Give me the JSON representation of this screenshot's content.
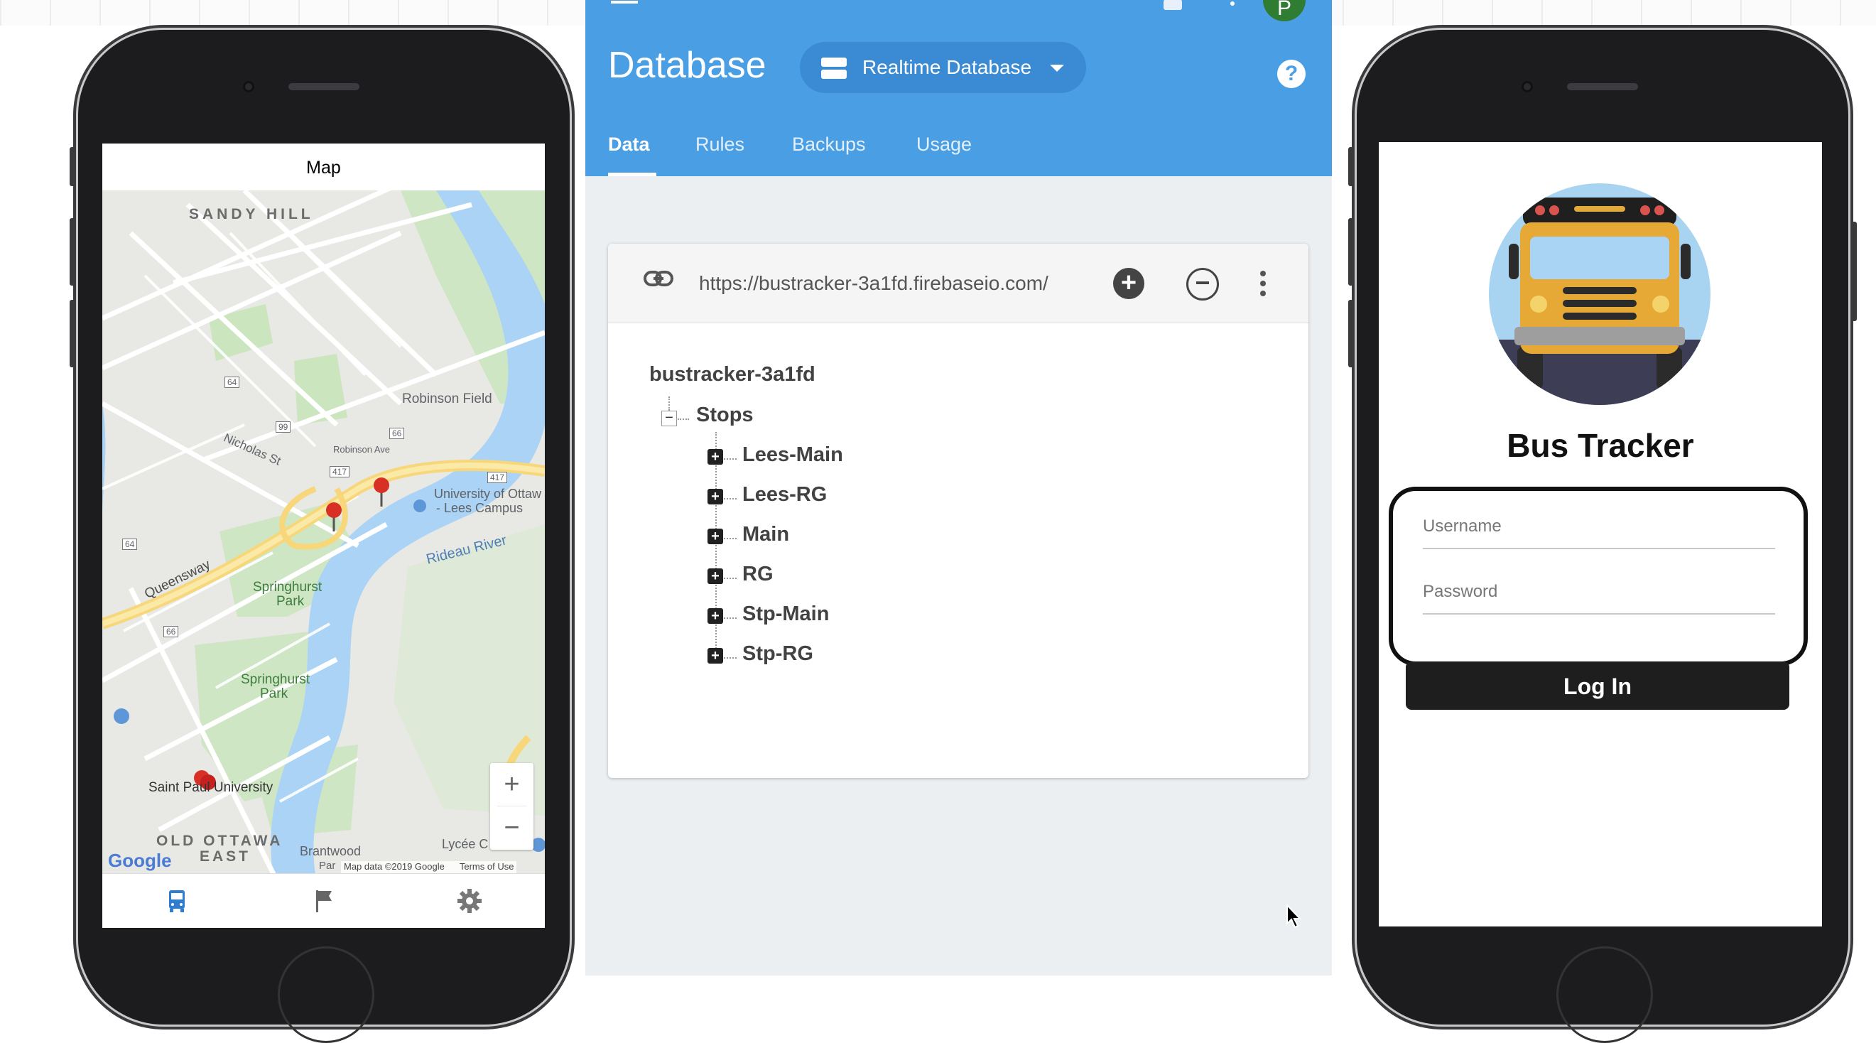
{
  "map_app": {
    "title": "Map",
    "zoom_in": "+",
    "zoom_out": "−",
    "labels": {
      "sandy_hill": "SANDY HILL",
      "robinson_field": "Robinson Field",
      "nicholas_st": "Nicholas St",
      "robinson_ave": "Robinson Ave",
      "university": "University of Ottaw",
      "lees_campus": "- Lees Campus",
      "queensway": "Queensway",
      "springhurst_park_1": "Springhurst",
      "springhurst_park_1b": "Park",
      "springhurst_park_2": "Springhurst",
      "springhurst_park_2b": "Park",
      "rideau_river": "Rideau River",
      "saint_paul": "Saint Paul University",
      "old_ottawa_east": "OLD OTTAWA",
      "old_ottawa_east_b": "EAST",
      "brantwood": "Brantwood",
      "lycee": "Lycée C",
      "google": "Google",
      "map_data": "Map data ©2019 Google",
      "terms": "Terms of Use",
      "par": "Par",
      "hwy_417": "417",
      "hwy_417b": "417",
      "rd_64": "64",
      "rd_64b": "64",
      "rd_99": "99",
      "rd_66": "66",
      "rd_66b": "66"
    },
    "tabs": [
      "bus-icon",
      "flag-icon",
      "gear-icon"
    ]
  },
  "firebase": {
    "title": "Database",
    "db_selector": "Realtime Database",
    "tabs": [
      "Data",
      "Rules",
      "Backups",
      "Usage"
    ],
    "url": "https://bustracker-3a1fd.firebaseio.com/",
    "root": "bustracker-3a1fd",
    "stops_node": "Stops",
    "children": [
      "Lees-Main",
      "Lees-RG",
      "Main",
      "RG",
      "Stp-Main",
      "Stp-RG"
    ],
    "help": "?",
    "avatar": "P"
  },
  "login_app": {
    "title": "Bus Tracker",
    "username_placeholder": "Username",
    "password_placeholder": "Password",
    "login_label": "Log In"
  },
  "colors": {
    "firebase_header": "#4a9ee3",
    "map_marker": "#d93025",
    "login_button": "#1e1e1e"
  }
}
